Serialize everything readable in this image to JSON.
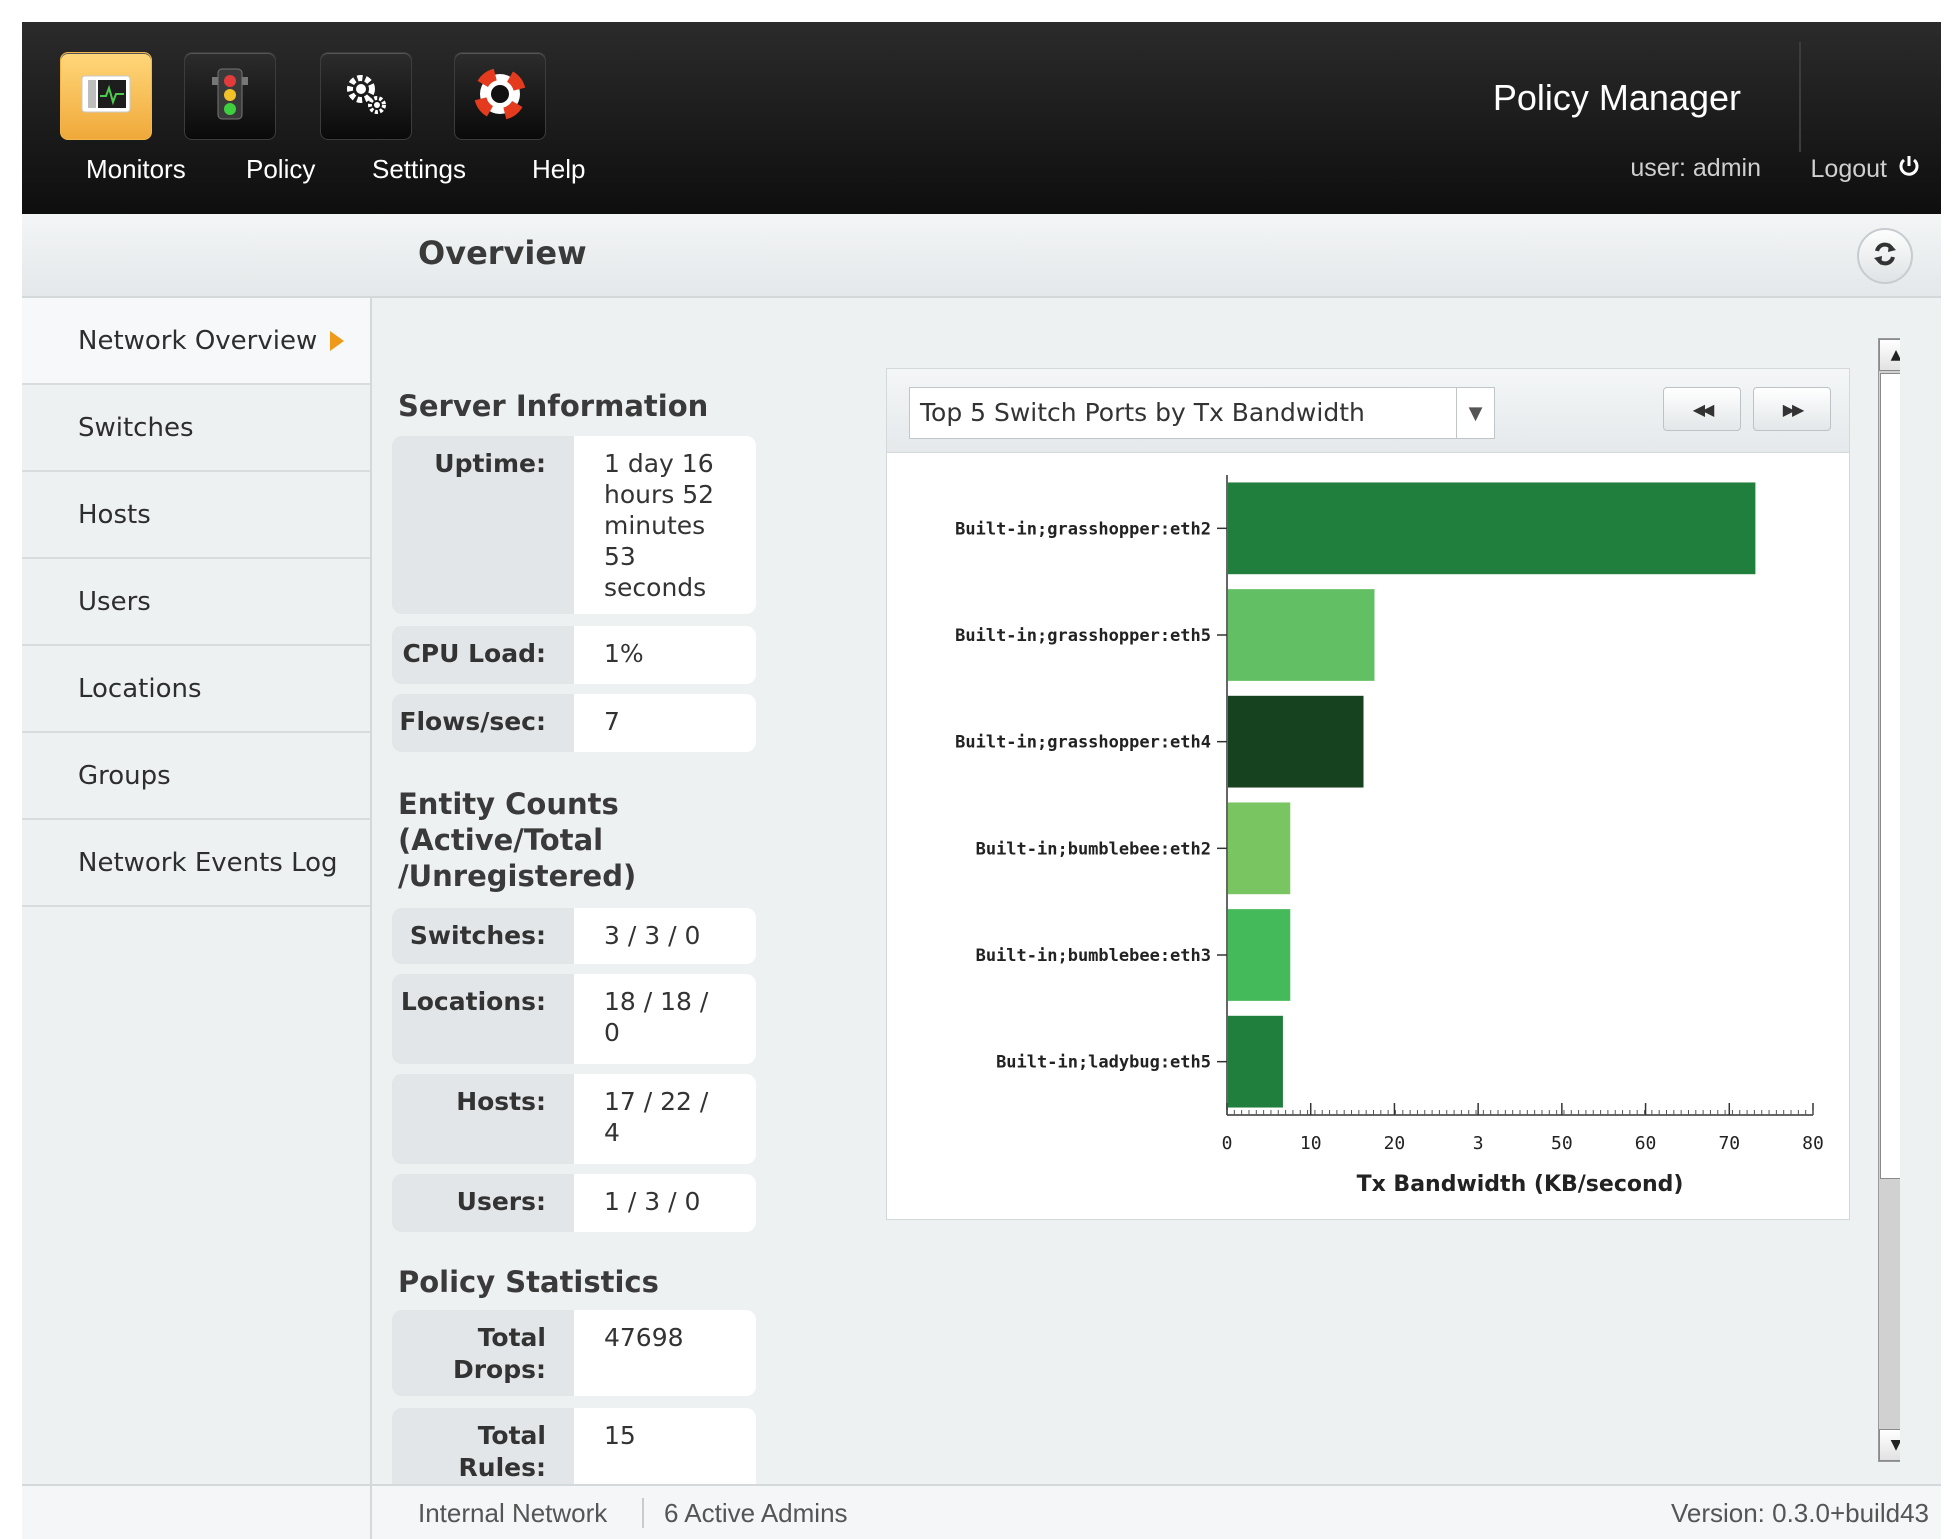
{
  "topbar": {
    "nav": [
      {
        "label": "Monitors",
        "icon": "monitor-icon",
        "active": true
      },
      {
        "label": "Policy",
        "icon": "traffic-light-icon",
        "active": false
      },
      {
        "label": "Settings",
        "icon": "gears-icon",
        "active": false
      },
      {
        "label": "Help",
        "icon": "lifebuoy-icon",
        "active": false
      }
    ],
    "app_title": "Policy Manager",
    "user": "user: admin",
    "logout": "Logout"
  },
  "header": {
    "title": "Overview"
  },
  "sidebar": {
    "items": [
      {
        "label": "Network Overview",
        "active": true
      },
      {
        "label": "Switches"
      },
      {
        "label": "Hosts"
      },
      {
        "label": "Users"
      },
      {
        "label": "Locations"
      },
      {
        "label": "Groups"
      },
      {
        "label": "Network Events Log"
      }
    ]
  },
  "server_info": {
    "title": "Server Information",
    "rows": [
      {
        "key": "Uptime:",
        "value": "1 day 16\nhours 52\nminutes\n53\nseconds"
      },
      {
        "key": "CPU Load:",
        "value": "1%"
      },
      {
        "key": "Flows/sec:",
        "value": "7"
      }
    ]
  },
  "entity_counts": {
    "title_line1": "Entity Counts",
    "title_line2": "(Active/Total",
    "title_line3": "/Unregistered)",
    "rows": [
      {
        "key": "Switches:",
        "value": "3 / 3 / 0"
      },
      {
        "key": "Locations:",
        "value": "18 / 18 /\n0"
      },
      {
        "key": "Hosts:",
        "value": "17 / 22 /\n4"
      },
      {
        "key": "Users:",
        "value": "1 / 3 / 0"
      }
    ]
  },
  "policy_stats": {
    "title": "Policy Statistics",
    "rows": [
      {
        "key_line1": "Total",
        "key_line2": "Drops:",
        "value": "47698"
      },
      {
        "key_line1": "Total",
        "key_line2": "Rules:",
        "value": "15"
      }
    ]
  },
  "chart_panel": {
    "selected": "Top 5 Switch Ports by Tx Bandwidth",
    "prev_icon": "rewind-icon",
    "next_icon": "fast-forward-icon"
  },
  "chart_data": {
    "type": "bar",
    "orientation": "horizontal",
    "categories": [
      "Built-in;grasshopper:eth2",
      "Built-in;grasshopper:eth5",
      "Built-in;grasshopper:eth4",
      "Built-in;bumblebee:eth2",
      "Built-in;bumblebee:eth3",
      "Built-in;ladybug:eth5"
    ],
    "values": [
      72,
      20,
      18.5,
      8.5,
      8.5,
      7.5
    ],
    "colors": [
      "#217f3e",
      "#63bf64",
      "#17421f",
      "#79c561",
      "#45ba5b",
      "#217f3e"
    ],
    "xlabel": "Tx Bandwidth (KB/second)",
    "xticks": [
      "0",
      "10",
      "20",
      "3",
      "50",
      "60",
      "70",
      "80"
    ],
    "xlim": [
      0,
      80
    ]
  },
  "footer": {
    "network": "Internal Network",
    "admins": "6 Active Admins",
    "version": "Version: 0.3.0+build43"
  },
  "colors": {
    "accent": "#f09a1a",
    "topbar": "#111111",
    "background": "#eef1f2"
  }
}
